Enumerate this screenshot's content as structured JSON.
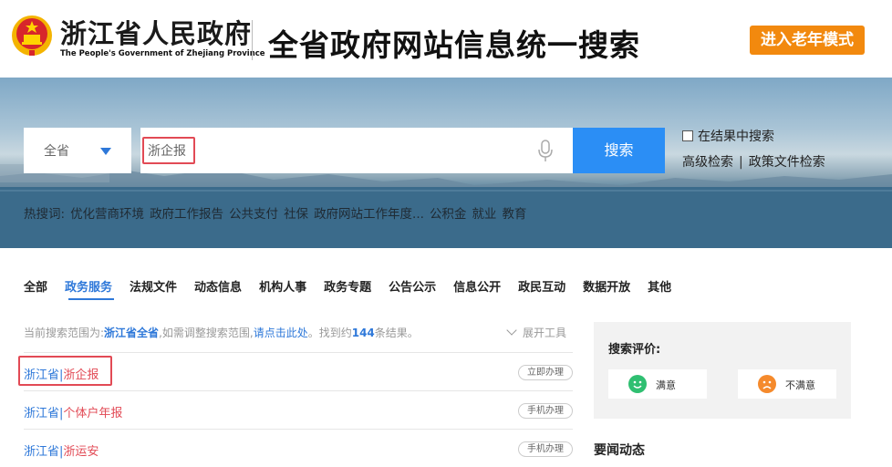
{
  "header": {
    "gov_name_cn": "浙江省人民政府",
    "gov_name_en": "The People's Government of Zhejiang Province",
    "site_title": "全省政府网站信息统一搜索",
    "elder_mode_label": "进入老年模式"
  },
  "search": {
    "scope": "全省",
    "query": "浙企报",
    "button_label": "搜索",
    "in_results_label": "在结果中搜索",
    "advanced_search_label": "高级检索",
    "policy_search_label": "政策文件检索"
  },
  "hot_words": {
    "label": "热搜词:",
    "items": [
      "优化营商环境",
      "政府工作报告",
      "公共支付",
      "社保",
      "政府网站工作年度...",
      "公积金",
      "就业",
      "教育"
    ]
  },
  "tabs": [
    "全部",
    "政务服务",
    "法规文件",
    "动态信息",
    "机构人事",
    "政务专题",
    "公告公示",
    "信息公开",
    "政民互动",
    "数据开放",
    "其他"
  ],
  "active_tab": "政务服务",
  "summary": {
    "prefix": "当前搜索范围为:",
    "scope": "浙江省全省",
    "middle": ",如需调整搜索范围,",
    "link": "请点击此处",
    "found_prefix": "。找到约",
    "count": "144",
    "found_suffix": "条结果。",
    "expand_label": "展开工具"
  },
  "results": [
    {
      "region": "浙江省",
      "sep": "|",
      "item": "浙企报",
      "badge": "立即办理"
    },
    {
      "region": "浙江省",
      "sep": "|",
      "item": "个体户年报",
      "badge": "手机办理"
    },
    {
      "region": "浙江省",
      "sep": "|",
      "item": "浙运安",
      "badge": "手机办理"
    }
  ],
  "rating": {
    "title": "搜索评价:",
    "satisfied": "满意",
    "unsatisfied": "不满意"
  },
  "news": {
    "title": "要闻动态"
  },
  "colors": {
    "accent_blue": "#2e78d9",
    "search_button": "#2b8ef5",
    "elder_button": "#f2890e",
    "highlight_red": "#e24a55",
    "satisfied_green": "#2fbf71",
    "unsatisfied_orange": "#f58a2c"
  }
}
